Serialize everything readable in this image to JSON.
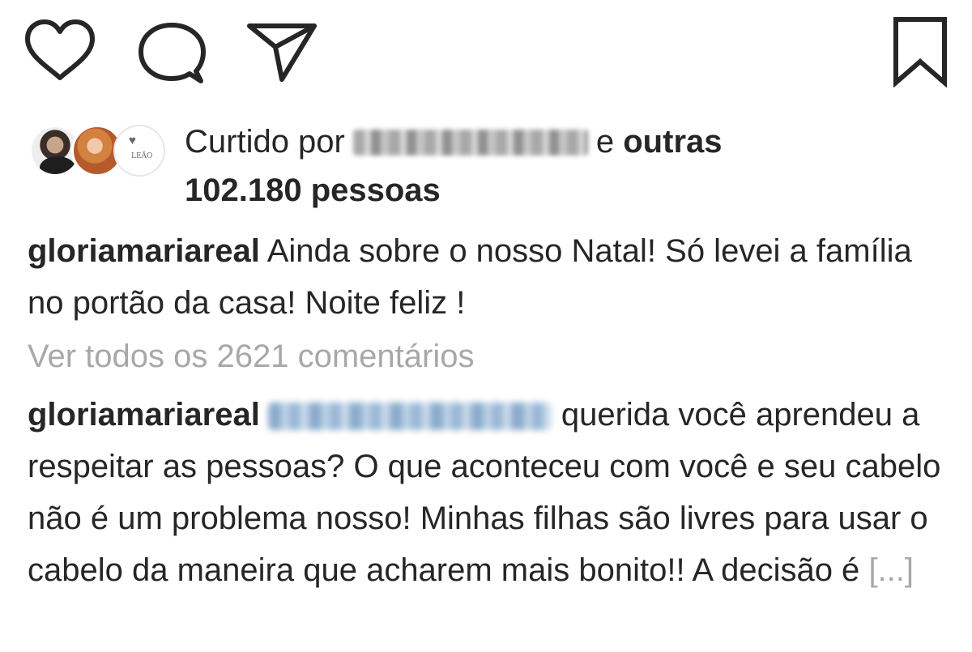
{
  "actions": {
    "like_icon": "heart-icon",
    "comment_icon": "comment-icon",
    "share_icon": "paper-plane-icon",
    "save_icon": "bookmark-icon"
  },
  "likes": {
    "prefix": "Curtido por",
    "connector": "e",
    "others_label": "outras",
    "count": "102.180 pessoas"
  },
  "caption": {
    "username": "gloriamariareal",
    "text": "Ainda sobre o nosso Natal! Só levei a família no portão da casa! Noite feliz !"
  },
  "view_all": "Ver todos os 2621 comentários",
  "comment": {
    "username": "gloriamariareal",
    "text": "querida você aprendeu a respeitar as pessoas? O que aconteceu com você e seu cabelo não é um problema nosso! Minhas filhas são livres para usar o cabelo da maneira que acharem mais bonito!! A decisão é",
    "more": "[...]"
  },
  "colors": {
    "text": "#262626",
    "muted": "#a8a8a8",
    "background": "#ffffff"
  }
}
